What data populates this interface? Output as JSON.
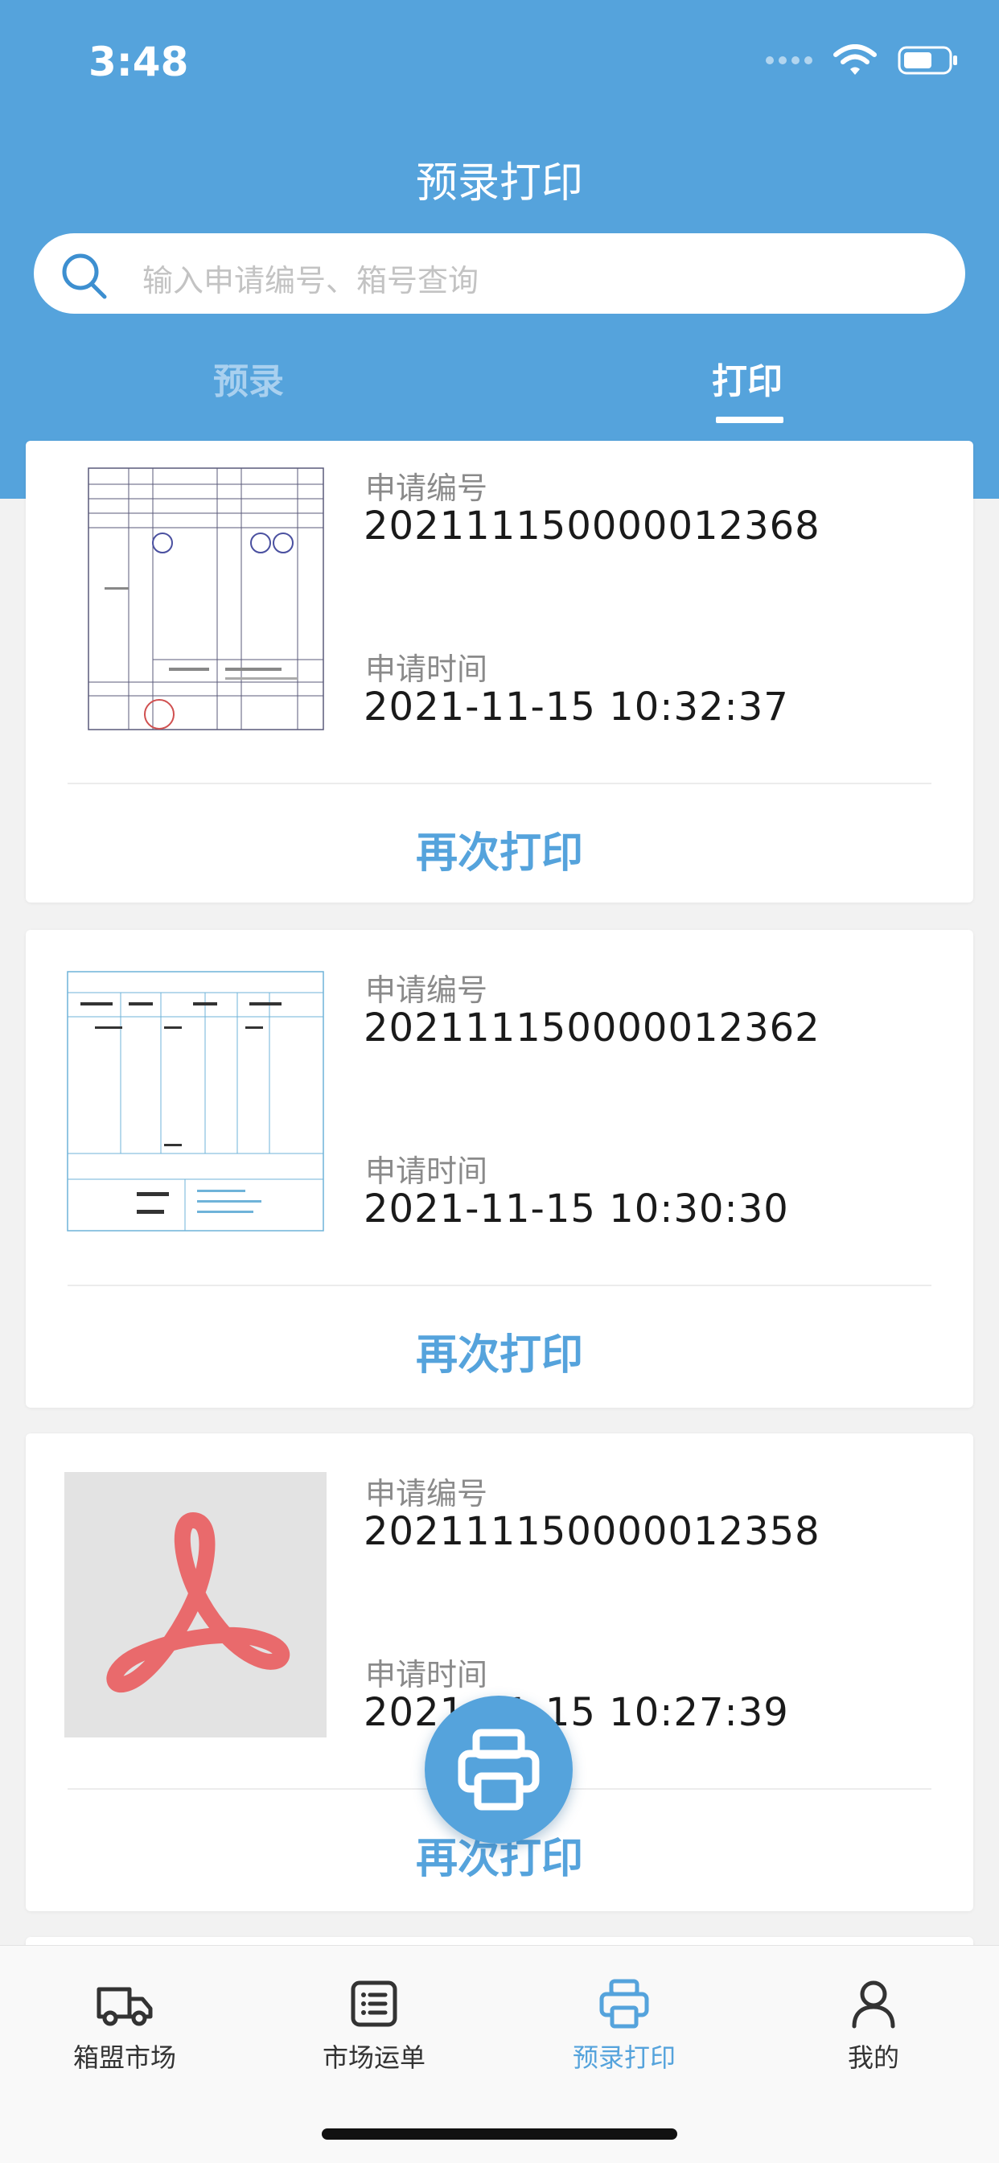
{
  "status_bar": {
    "time": "3:48"
  },
  "header": {
    "title": "预录打印",
    "search": {
      "placeholder": "输入申请编号、箱号查询"
    },
    "tabs": [
      {
        "label": "预录",
        "active": false
      },
      {
        "label": "打印",
        "active": true
      }
    ]
  },
  "records": [
    {
      "number_label": "申请编号",
      "number": "202111150000012368",
      "time_label": "申请时间",
      "time": "2021-11-15 10:32:37",
      "action": "再次打印",
      "thumbnail": "document-thumbnail"
    },
    {
      "number_label": "申请编号",
      "number": "202111150000012362",
      "time_label": "申请时间",
      "time": "2021-11-15 10:30:30",
      "action": "再次打印",
      "thumbnail": "document-thumbnail"
    },
    {
      "number_label": "申请编号",
      "number": "202111150000012358",
      "time_label": "申请时间",
      "time": "2021-11-15 10:27:39",
      "action": "再次打印",
      "thumbnail": "pdf-icon"
    }
  ],
  "fab": {
    "icon": "printer-icon"
  },
  "tabbar": {
    "items": [
      {
        "label": "箱盟市场",
        "icon": "truck-icon",
        "active": false
      },
      {
        "label": "市场运单",
        "icon": "list-icon",
        "active": false
      },
      {
        "label": "预录打印",
        "icon": "printer-icon",
        "active": true
      },
      {
        "label": "我的",
        "icon": "user-icon",
        "active": false
      }
    ]
  },
  "colors": {
    "accent": "#55a3dc",
    "background": "#f2f2f2",
    "card": "#ffffff"
  }
}
